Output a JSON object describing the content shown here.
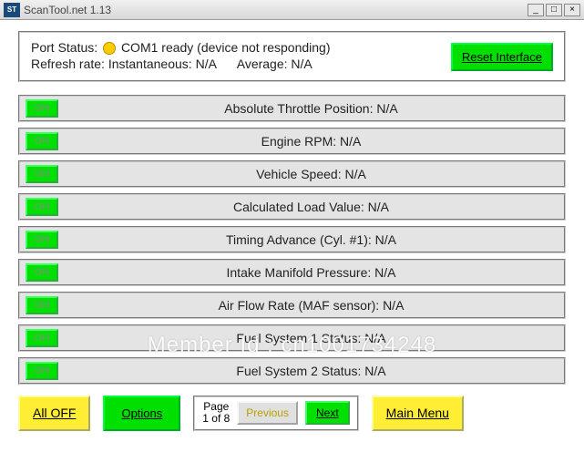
{
  "window": {
    "app_icon": "ST",
    "title": "ScanTool.net 1.13"
  },
  "status": {
    "port_label": "Port Status:",
    "port_value": "COM1 ready (device not responding)",
    "refresh_label": "Refresh rate:",
    "inst_label": "Instantaneous:",
    "inst_value": "N/A",
    "avg_label": "Average:",
    "avg_value": "N/A",
    "reset_btn": "Reset Interface"
  },
  "rows": [
    {
      "on": "ON",
      "label": "Absolute Throttle Position:",
      "value": "N/A"
    },
    {
      "on": "ON",
      "label": "Engine RPM:",
      "value": "N/A"
    },
    {
      "on": "ON",
      "label": "Vehicle Speed:",
      "value": "N/A"
    },
    {
      "on": "ON",
      "label": "Calculated Load Value:",
      "value": "N/A"
    },
    {
      "on": "ON",
      "label": "Timing Advance (Cyl. #1):",
      "value": "N/A"
    },
    {
      "on": "ON",
      "label": "Intake Manifold Pressure:",
      "value": "N/A"
    },
    {
      "on": "ON",
      "label": "Air Flow Rate (MAF sensor):",
      "value": "N/A"
    },
    {
      "on": "ON",
      "label": "Fuel System 1 Status:",
      "value": "N/A"
    },
    {
      "on": "ON",
      "label": "Fuel System 2 Status:",
      "value": "N/A"
    }
  ],
  "footer": {
    "all_off": "All OFF",
    "options": "Options",
    "page_label": "Page",
    "page_value": "1 of 8",
    "prev": "Previous",
    "next": "Next",
    "main_menu": "Main Menu"
  },
  "watermark": "Member Id : cn1001734248"
}
